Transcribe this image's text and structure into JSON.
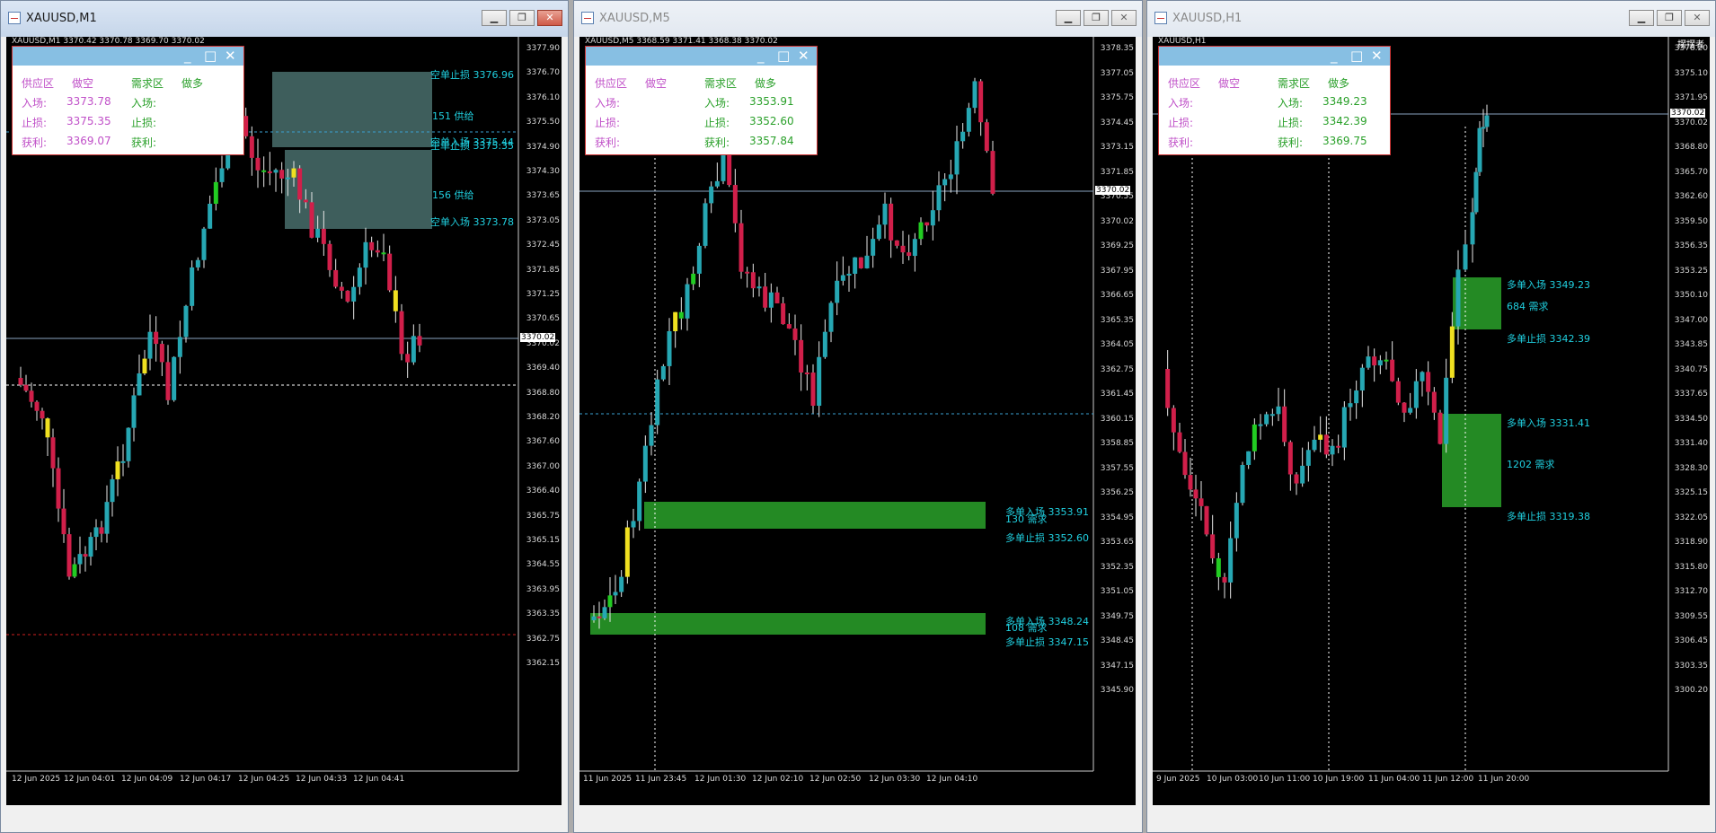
{
  "windows": [
    {
      "title": "XAUUSD,M1",
      "active": true,
      "header": "XAUUSD,M1  3370.42 3370.78 3369.70 3370.02",
      "ticks": [
        "3377.90",
        "3376.70",
        "3376.10",
        "3375.50",
        "3374.90",
        "3374.30",
        "3373.65",
        "3373.05",
        "3372.45",
        "3371.85",
        "3371.25",
        "3370.65",
        "3370.02",
        "3369.40",
        "3368.80",
        "3368.20",
        "3367.60",
        "3367.00",
        "3366.40",
        "3365.75",
        "3365.15",
        "3364.55",
        "3363.95",
        "3363.35",
        "3362.75",
        "3362.15"
      ],
      "current_price": "3370.02",
      "times": [
        "12 Jun 2025",
        "12 Jun 04:01",
        "12 Jun 04:09",
        "12 Jun 04:17",
        "12 Jun 04:25",
        "12 Jun 04:33",
        "12 Jun 04:41"
      ],
      "panel": {
        "supply": "供应区",
        "short": "做空",
        "demand": "需求区",
        "long": "做多",
        "entry_label": "入场:",
        "stop_label": "止损:",
        "profit_label": "获利:",
        "short_entry": "3373.78",
        "short_stop": "3375.35",
        "short_profit": "3369.07",
        "long_entry": "",
        "long_stop": "",
        "long_profit": ""
      },
      "zones": [
        "空单止损 3376.96",
        "151 供给",
        "空单入场 3375.44",
        "空单止损 3375.35",
        "156 供给",
        "空单入场 3373.78"
      ]
    },
    {
      "title": "XAUUSD,M5",
      "active": false,
      "header": "XAUUSD,M5  3368.59 3371.41 3368.38 3370.02",
      "ticks": [
        "3378.35",
        "3377.05",
        "3375.75",
        "3374.45",
        "3373.15",
        "3371.85",
        "3370.55",
        "3370.02",
        "3369.25",
        "3367.95",
        "3366.65",
        "3365.35",
        "3364.05",
        "3362.75",
        "3361.45",
        "3360.15",
        "3358.85",
        "3357.55",
        "3356.25",
        "3354.95",
        "3353.65",
        "3352.35",
        "3351.05",
        "3349.75",
        "3348.45",
        "3347.15",
        "3345.90"
      ],
      "current_price": "3370.02",
      "times": [
        "11 Jun 2025",
        "11 Jun 23:45",
        "12 Jun 01:30",
        "12 Jun 02:10",
        "12 Jun 02:50",
        "12 Jun 03:30",
        "12 Jun 04:10"
      ],
      "panel": {
        "supply": "供应区",
        "short": "做空",
        "demand": "需求区",
        "long": "做多",
        "entry_label": "入场:",
        "stop_label": "止损:",
        "profit_label": "获利:",
        "short_entry": "",
        "short_stop": "",
        "short_profit": "",
        "long_entry": "3353.91",
        "long_stop": "3352.60",
        "long_profit": "3357.84"
      },
      "zones": [
        "多单入场 3353.91",
        "130 需求",
        "多单止损 3352.60",
        "多单入场 3348.24",
        "108 需求",
        "多单止损 3347.15"
      ]
    },
    {
      "title": "XAUUSD,H1",
      "active": false,
      "header": "XAUUSD,H1",
      "corner_label": "摆摆者",
      "ticks": [
        "3378.20",
        "3375.10",
        "3371.95",
        "3370.02",
        "3368.80",
        "3365.70",
        "3362.60",
        "3359.50",
        "3356.35",
        "3353.25",
        "3350.10",
        "3347.00",
        "3343.85",
        "3340.75",
        "3337.65",
        "3334.50",
        "3331.40",
        "3328.30",
        "3325.15",
        "3322.05",
        "3318.90",
        "3315.80",
        "3312.70",
        "3309.55",
        "3306.45",
        "3303.35",
        "3300.20"
      ],
      "current_price": "3370.02",
      "times": [
        "9 Jun 2025",
        "10 Jun 03:00",
        "10 Jun 11:00",
        "10 Jun 19:00",
        "11 Jun 04:00",
        "11 Jun 12:00",
        "11 Jun 20:00"
      ],
      "panel": {
        "supply": "供应区",
        "short": "做空",
        "demand": "需求区",
        "long": "做多",
        "entry_label": "入场:",
        "stop_label": "止损:",
        "profit_label": "获利:",
        "short_entry": "",
        "short_stop": "",
        "short_profit": "",
        "long_entry": "3349.23",
        "long_stop": "3342.39",
        "long_profit": "3369.75"
      },
      "zones": [
        "多单入场 3349.23",
        "684 需求",
        "多单止损 3342.39",
        "多单入场 3331.41",
        "1202 需求",
        "多单止损 3319.38"
      ]
    }
  ],
  "colors": {
    "bull": "#26a7b3",
    "bear": "#d11f4a",
    "zone_supply": "#3e5e5c",
    "zone_demand": "#248a24",
    "zone_text": "#20d0e0",
    "doji": "#f0e020",
    "bull_green": "#22cc22"
  }
}
